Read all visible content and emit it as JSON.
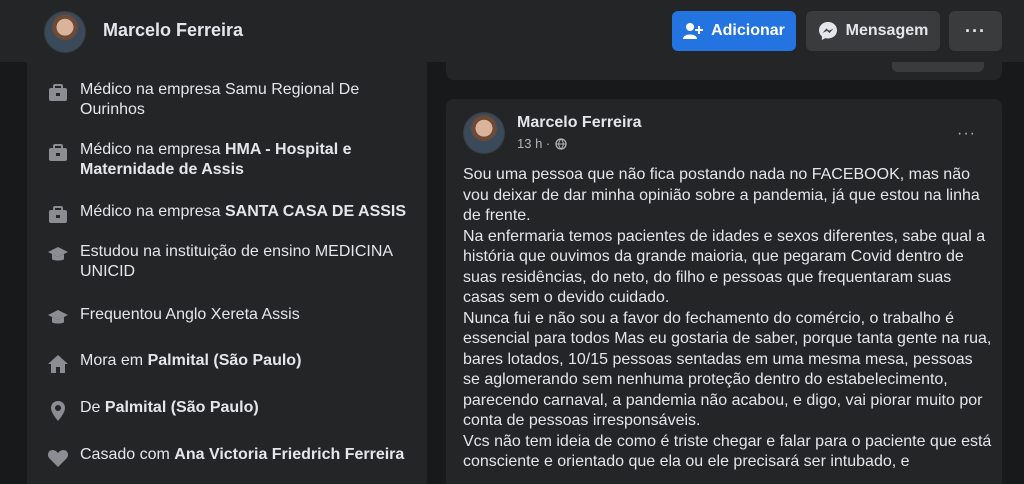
{
  "header": {
    "name": "Marcelo Ferreira",
    "add_label": "Adicionar",
    "message_label": "Mensagem",
    "more_label": "···"
  },
  "intro": [
    {
      "icon": "briefcase-icon",
      "prefix": "Médico na empresa Samu Regional De Ourinhos",
      "bold": ""
    },
    {
      "icon": "briefcase-icon",
      "prefix": "Médico na empresa ",
      "bold": "HMA - Hospital e Maternidade de Assis"
    },
    {
      "icon": "briefcase-icon",
      "prefix": "Médico na empresa ",
      "bold": "SANTA CASA DE ASSIS"
    },
    {
      "icon": "graduation-cap-icon",
      "prefix": "Estudou na instituição de ensino MEDICINA UNICID",
      "bold": ""
    },
    {
      "icon": "graduation-cap-icon",
      "prefix": "Frequentou Anglo Xereta Assis",
      "bold": ""
    },
    {
      "icon": "home-icon",
      "prefix": "Mora em ",
      "bold": "Palmital (São Paulo)"
    },
    {
      "icon": "location-pin-icon",
      "prefix": "De ",
      "bold": "Palmital (São Paulo)"
    },
    {
      "icon": "heart-icon",
      "prefix": "Casado com ",
      "bold": "Ana Victoria Friedrich Ferreira"
    }
  ],
  "post": {
    "author": "Marcelo Ferreira",
    "time": "13 h ·",
    "more_label": "···",
    "paragraphs": [
      "Sou uma pessoa que não fica postando nada no FACEBOOK, mas não vou deixar de dar minha opinião sobre a pandemia, já que estou na linha de frente.",
      "Na enfermaria temos pacientes de idades e sexos diferentes, sabe qual a história que ouvimos da grande maioria, que pegaram Covid dentro de suas residências, do neto, do filho e pessoas que frequentaram suas casas sem o devido cuidado.",
      "Nunca fui e não sou a favor do fechamento do comércio, o trabalho é essencial para todos Mas eu gostaria de saber, porque tanta gente na rua, bares lotados, 10/15 pessoas sentadas em uma mesma mesa, pessoas se aglomerando sem nenhuma proteção dentro do estabelecimento, parecendo carnaval, a pandemia não acabou, e digo, vai piorar muito por conta de pessoas irresponsáveis.",
      "Vcs não tem ideia de como é triste chegar e falar para o paciente que está consciente e orientado que ela ou ele precisará ser intubado, e"
    ]
  }
}
